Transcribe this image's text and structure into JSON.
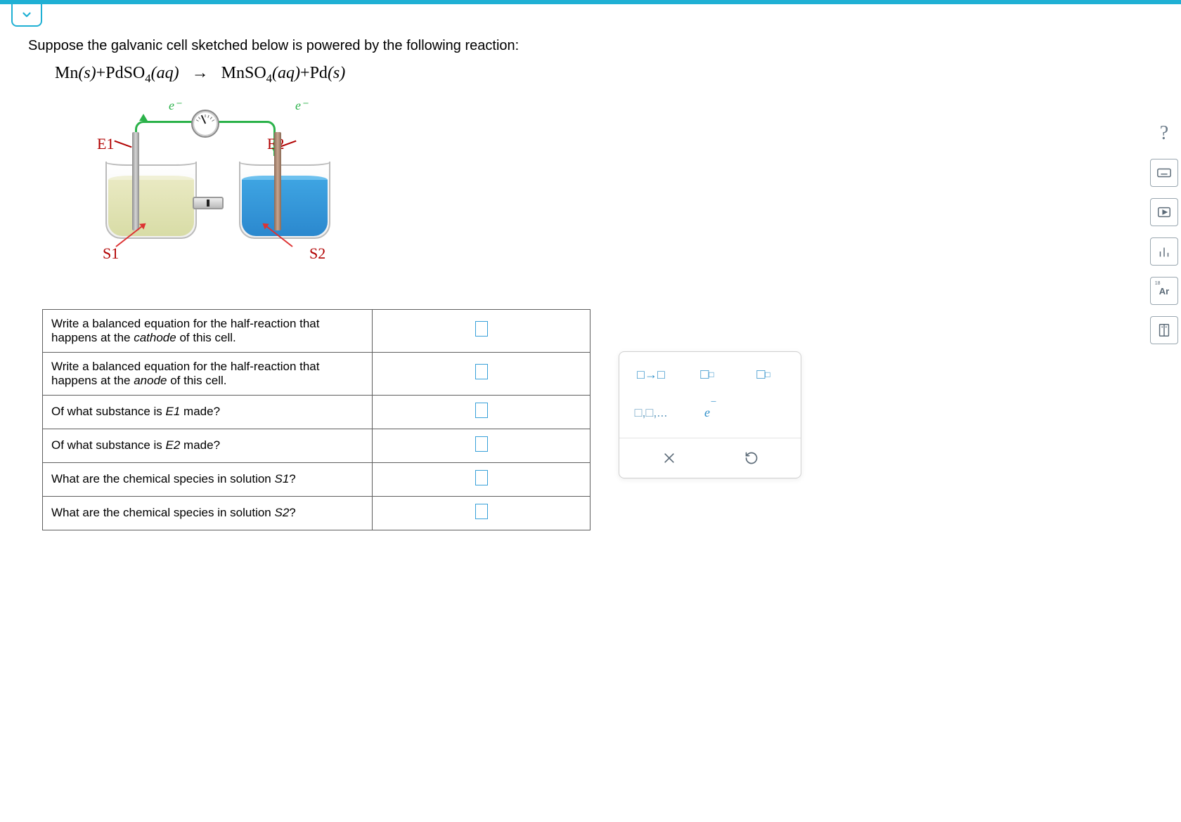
{
  "prompt": "Suppose the galvanic cell sketched below is powered by the following reaction:",
  "equation": {
    "part1": "Mn",
    "state1": "(s)",
    "plus1": "+",
    "part2": "PdSO",
    "sub2": "4",
    "state2": "(aq)",
    "arrow": "→",
    "part3": "MnSO",
    "sub3": "4",
    "state3": "(aq)",
    "plus2": "+",
    "part4": "Pd",
    "state4": "(s)"
  },
  "diagram": {
    "e_minus1": "e⁻",
    "e_minus2": "e⁻",
    "E1": "E1",
    "E2": "E2",
    "S1": "S1",
    "S2": "S2"
  },
  "questions": [
    {
      "q_pre": "Write a balanced equation for the half-reaction that happens at the ",
      "q_em": "cathode",
      "q_post": " of this cell."
    },
    {
      "q_pre": "Write a balanced equation for the half-reaction that happens at the ",
      "q_em": "anode",
      "q_post": " of this cell."
    },
    {
      "q_pre": "Of what substance is ",
      "q_em": "E1",
      "q_post": " made?"
    },
    {
      "q_pre": "Of what substance is ",
      "q_em": "E2",
      "q_post": " made?"
    },
    {
      "q_pre": "What are the chemical species in solution ",
      "q_em": "S1",
      "q_post": "?"
    },
    {
      "q_pre": "What are the chemical species in solution ",
      "q_em": "S2",
      "q_post": "?"
    }
  ],
  "palette": {
    "arrow": "□→□",
    "subscript": "□",
    "sub_small": "□",
    "superscript": "□",
    "sup_small": "□",
    "list": "□,□,...",
    "electron_e": "e",
    "electron_bar": "‾"
  },
  "sidebar": {
    "help": "?",
    "periodic": "Ar",
    "periodic_num": "18"
  }
}
